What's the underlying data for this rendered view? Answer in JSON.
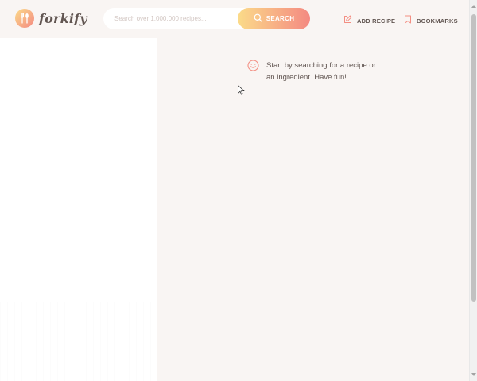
{
  "header": {
    "logo_text": "forkify",
    "search": {
      "placeholder": "Search over 1,000,000 recipes...",
      "value": "",
      "button_label": "SEARCH"
    },
    "nav": {
      "add_recipe_label": "ADD RECIPE",
      "bookmarks_label": "BOOKMARKS"
    }
  },
  "recipe": {
    "message": "Start by searching for a recipe or an ingredient. Have fun!"
  },
  "icons": {
    "logo": "fork-spoon-icon",
    "search": "search-icon",
    "add_recipe": "edit-icon",
    "bookmarks": "bookmark-icon",
    "message": "smile-icon"
  },
  "colors": {
    "accent_start": "#fbdb89",
    "accent_end": "#f48982",
    "text": "#615551",
    "background": "#f9f5f3"
  }
}
